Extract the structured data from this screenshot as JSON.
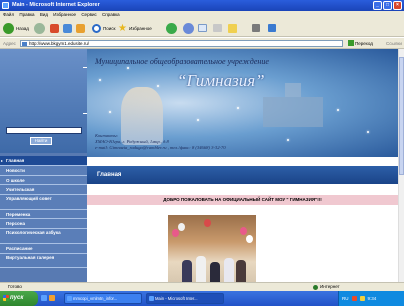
{
  "window": {
    "title": "Main - Microsoft Internet Explorer",
    "buttons": {
      "minimize": "_",
      "maximize": "□",
      "close": "×"
    }
  },
  "menu": [
    "Файл",
    "Правка",
    "Вид",
    "Избранное",
    "Сервис",
    "Справка"
  ],
  "toolbar": {
    "back": "Назад",
    "search": "Поиск",
    "favorites": "Избранное"
  },
  "address": {
    "label": "Адрес",
    "url": "http://www.bkgym1.edusite.ru/",
    "go": "Переход",
    "links": "Ссылки"
  },
  "sidebar": {
    "search_button": "Найти",
    "nav": [
      {
        "label": "Главная",
        "active": true
      },
      {
        "label": "Новости"
      },
      {
        "label": "О школе"
      },
      {
        "label": "Учительская"
      },
      {
        "label": "Управляющий совет",
        "tall": true
      },
      {
        "label": "Переменка"
      },
      {
        "label": "Персона"
      },
      {
        "label": "Психологическая азбука",
        "tall": true
      },
      {
        "label": "Расписание"
      },
      {
        "label": "Виртуальная галерея",
        "tall": true
      }
    ]
  },
  "banner": {
    "line1": "Муниципальное общеобразовательное учреждение",
    "line2": "“Гимназия”",
    "contacts": [
      "Контакты:",
      "ХМАО-Югра, г. Радужный, 1мкр., д.8",
      "e-mail: Gimnazia_raduga@rambler.ru , тел./факс: 8 (34668) 3-32-70"
    ]
  },
  "content": {
    "heading": "Главная",
    "welcome": "ДОБРО ПОЖАЛОВАТЬ НА ОФИЦИАЛЬНЫЙ САЙТ МОУ \" ГИМНАЗИЯ\"!!!"
  },
  "status": {
    "left": "Готово",
    "zone": "Интернет"
  },
  "taskbar": {
    "start": "пуск",
    "tasks": [
      {
        "label": "mmcopi_vmlmtn_infor..."
      },
      {
        "label": "Main - Microsoft Inter...",
        "active": true
      }
    ],
    "tray_lang": "RU",
    "clock": "9:34"
  },
  "colors": {
    "sidebar": "#587ab2",
    "heading_bar": "#1a4488",
    "welcome_bg": "#f0c8d0",
    "title_bar": "#2a5ddc"
  }
}
